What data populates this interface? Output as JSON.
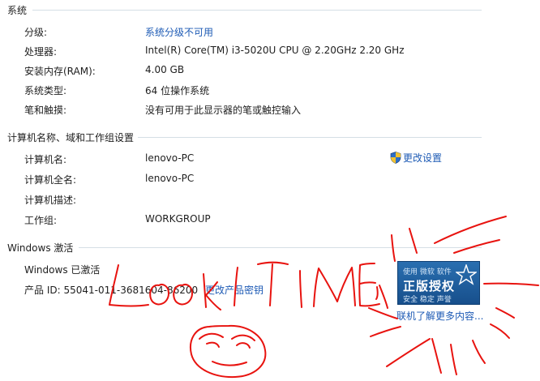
{
  "system": {
    "header": "系统",
    "rows": [
      {
        "label": "分级:",
        "value": "系统分级不可用"
      },
      {
        "label": "处理器:",
        "value": "Intel(R) Core(TM) i3-5020U CPU @ 2.20GHz   2.20 GHz"
      },
      {
        "label": "安装内存(RAM):",
        "value": "4.00 GB"
      },
      {
        "label": "系统类型:",
        "value": "64 位操作系统"
      },
      {
        "label": "笔和触摸:",
        "value": "没有可用于此显示器的笔或触控输入"
      }
    ]
  },
  "computer": {
    "header": "计算机名称、域和工作组设置",
    "change_settings": "更改设置",
    "rows": [
      {
        "label": "计算机名:",
        "value": "lenovo-PC"
      },
      {
        "label": "计算机全名:",
        "value": "lenovo-PC"
      },
      {
        "label": "计算机描述:",
        "value": ""
      },
      {
        "label": "工作组:",
        "value": "WORKGROUP"
      }
    ]
  },
  "activation": {
    "header": "Windows 激活",
    "status": "Windows 已激活",
    "product_id": "产品 ID: 55041-011-3681604-86200",
    "change_key": "更改产品密钥",
    "badge": {
      "top": "使用 微软 软件",
      "main": "正版授权",
      "sub": "安全 稳定 声誉"
    },
    "learn_more": "联机了解更多内容..."
  },
  "colors": {
    "link": "#1e5bb5",
    "scribble": "#e8130f",
    "badge": "#1f5f9f"
  }
}
